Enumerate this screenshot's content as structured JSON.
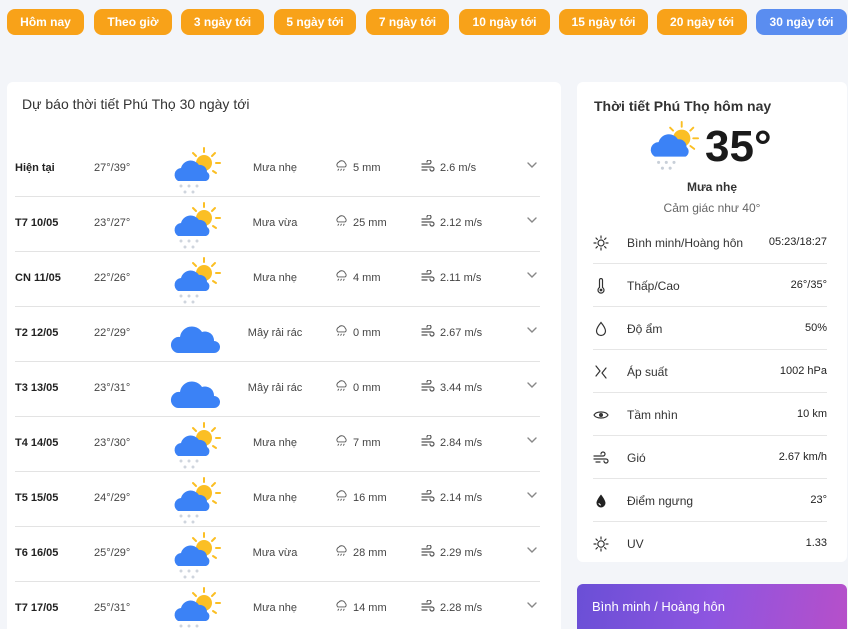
{
  "tabs": [
    {
      "label": "Hôm nay"
    },
    {
      "label": "Theo giờ"
    },
    {
      "label": "3 ngày tới"
    },
    {
      "label": "5 ngày tới"
    },
    {
      "label": "7 ngày tới"
    },
    {
      "label": "10 ngày tới"
    },
    {
      "label": "15 ngày tới"
    },
    {
      "label": "20 ngày tới"
    },
    {
      "label": "30 ngày tới",
      "active": true
    }
  ],
  "forecast": {
    "title": "Dự báo thời tiết Phú Thọ 30 ngày tới",
    "rows": [
      {
        "day": "Hiện tại",
        "temp": "27°/39°",
        "icon": "sun-cloud-rain-icon",
        "desc": "Mưa nhẹ",
        "rain": "5 mm",
        "wind": "2.6 m/s"
      },
      {
        "day": "T7 10/05",
        "temp": "23°/27°",
        "icon": "sun-cloud-rain-icon",
        "desc": "Mưa vừa",
        "rain": "25 mm",
        "wind": "2.12 m/s"
      },
      {
        "day": "CN 11/05",
        "temp": "22°/26°",
        "icon": "sun-cloud-rain-icon",
        "desc": "Mưa nhẹ",
        "rain": "4 mm",
        "wind": "2.11 m/s"
      },
      {
        "day": "T2 12/05",
        "temp": "22°/29°",
        "icon": "cloud-icon",
        "desc": "Mây rải rác",
        "rain": "0 mm",
        "wind": "2.67 m/s"
      },
      {
        "day": "T3 13/05",
        "temp": "23°/31°",
        "icon": "cloud-icon",
        "desc": "Mây rải rác",
        "rain": "0 mm",
        "wind": "3.44 m/s"
      },
      {
        "day": "T4 14/05",
        "temp": "23°/30°",
        "icon": "sun-cloud-rain-icon",
        "desc": "Mưa nhẹ",
        "rain": "7 mm",
        "wind": "2.84 m/s"
      },
      {
        "day": "T5 15/05",
        "temp": "24°/29°",
        "icon": "sun-cloud-rain-icon",
        "desc": "Mưa nhẹ",
        "rain": "16 mm",
        "wind": "2.14 m/s"
      },
      {
        "day": "T6 16/05",
        "temp": "25°/29°",
        "icon": "sun-cloud-rain-icon",
        "desc": "Mưa vừa",
        "rain": "28 mm",
        "wind": "2.29 m/s"
      },
      {
        "day": "T7 17/05",
        "temp": "25°/31°",
        "icon": "sun-cloud-rain-icon",
        "desc": "Mưa nhẹ",
        "rain": "14 mm",
        "wind": "2.28 m/s"
      }
    ]
  },
  "today": {
    "title": "Thời tiết Phú Thọ hôm nay",
    "temp": "35°",
    "condition": "Mưa nhẹ",
    "feels_like": "Cảm giác như 40°",
    "details": [
      {
        "icon": "sun-icon",
        "label": "Bình minh/Hoàng hôn",
        "value": "05:23/18:27"
      },
      {
        "icon": "thermometer-icon",
        "label": "Thấp/Cao",
        "value": "26°/35°"
      },
      {
        "icon": "droplet-icon",
        "label": "Độ ẩm",
        "value": "50%"
      },
      {
        "icon": "pressure-icon",
        "label": "Áp suất",
        "value": "1002 hPa"
      },
      {
        "icon": "eye-icon",
        "label": "Tầm nhìn",
        "value": "10 km"
      },
      {
        "icon": "wind-icon",
        "label": "Gió",
        "value": "2.67 km/h"
      },
      {
        "icon": "dew-point-icon",
        "label": "Điểm ngưng",
        "value": "23°"
      },
      {
        "icon": "uv-icon",
        "label": "UV",
        "value": "1.33"
      }
    ]
  },
  "sun_card": {
    "title": "Bình minh / Hoàng hôn"
  },
  "colors": {
    "tab": "#f8a219",
    "tab_active": "#5a8df0",
    "cloud": "#3b82f6",
    "sun": "#fbbf24"
  }
}
